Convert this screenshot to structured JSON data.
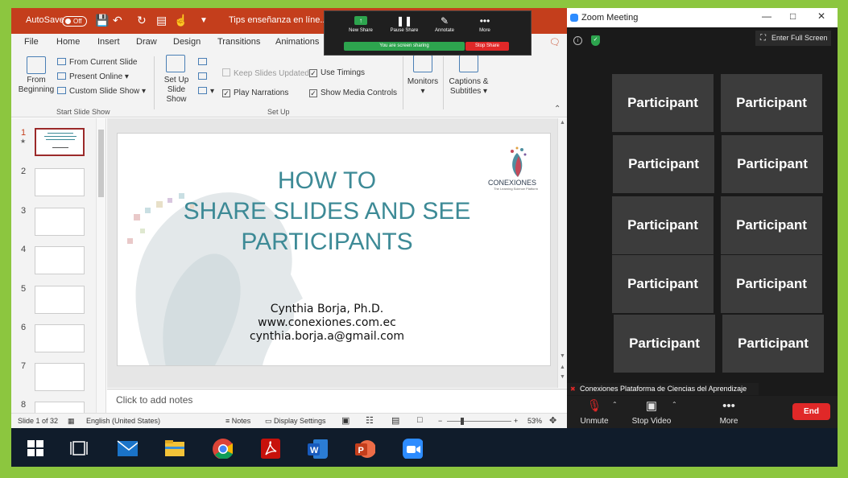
{
  "ppt": {
    "autosave_label": "AutoSave",
    "autosave_state": "Off",
    "doc_title": "Tips enseñanza en líne...",
    "menu": [
      "File",
      "Home",
      "Insert",
      "Draw",
      "Design",
      "Transitions",
      "Animations"
    ],
    "ribbon": {
      "from_beginning_1": "From",
      "from_beginning_2": "Beginning",
      "from_current": "From Current Slide",
      "present_online": "Present Online",
      "custom_show": "Custom Slide Show",
      "group_start": "Start Slide Show",
      "setup_1": "Set Up",
      "setup_2": "Slide Show",
      "keep_slides": "Keep Slides Updated",
      "play_narrations": "Play Narrations",
      "use_timings": "Use Timings",
      "show_media": "Show Media Controls",
      "group_setup": "Set Up",
      "monitors": "Monitors",
      "captions_1": "Captions &",
      "captions_2": "Subtitles"
    },
    "thumbnails": [
      "1",
      "2",
      "3",
      "4",
      "5",
      "6",
      "7",
      "8"
    ],
    "slide": {
      "title_1": "HOW TO",
      "title_2": "SHARE SLIDES AND SEE",
      "title_3": "PARTICIPANTS",
      "author": "Cynthia Borja, Ph.D.",
      "website": "www.conexiones.com.ec",
      "email": "cynthia.borja.a@gmail.com",
      "logo": "CONEXIONES",
      "logo_tagline": "The Learning Science Platform"
    },
    "notes_placeholder": "Click to add notes",
    "status": {
      "slide_of": "Slide 1 of 32",
      "language": "English (United States)",
      "notes": "Notes",
      "display_settings": "Display Settings",
      "zoom": "53%"
    }
  },
  "share_toolbar": {
    "new_share": "New Share",
    "pause_share": "Pause Share",
    "annotate": "Annotate",
    "more": "More",
    "sharing_status": "You are screen sharing",
    "stop_share": "Stop Share"
  },
  "zoom": {
    "title": "Zoom Meeting",
    "enter_full_screen": "Enter Full Screen",
    "participants": [
      "Participant",
      "Participant",
      "Participant",
      "Participant",
      "Participant",
      "Participant",
      "Participant",
      "Participant",
      "Participant",
      "Participant"
    ],
    "meeting_name": "Conexiones Plataforma de Ciencias del Aprendizaje",
    "controls": {
      "unmute": "Unmute",
      "stop_video": "Stop Video",
      "more": "More",
      "end": "End"
    }
  },
  "colors": {
    "ppt_accent": "#c43e1c",
    "slide_title": "#3d8a96",
    "zoom_end": "#e02828",
    "share_green": "#2da44e",
    "border_green": "#8cc63f"
  },
  "taskbar": [
    "windows-start",
    "task-view",
    "mail",
    "file-explorer",
    "chrome",
    "acrobat",
    "word",
    "powerpoint",
    "zoom"
  ]
}
